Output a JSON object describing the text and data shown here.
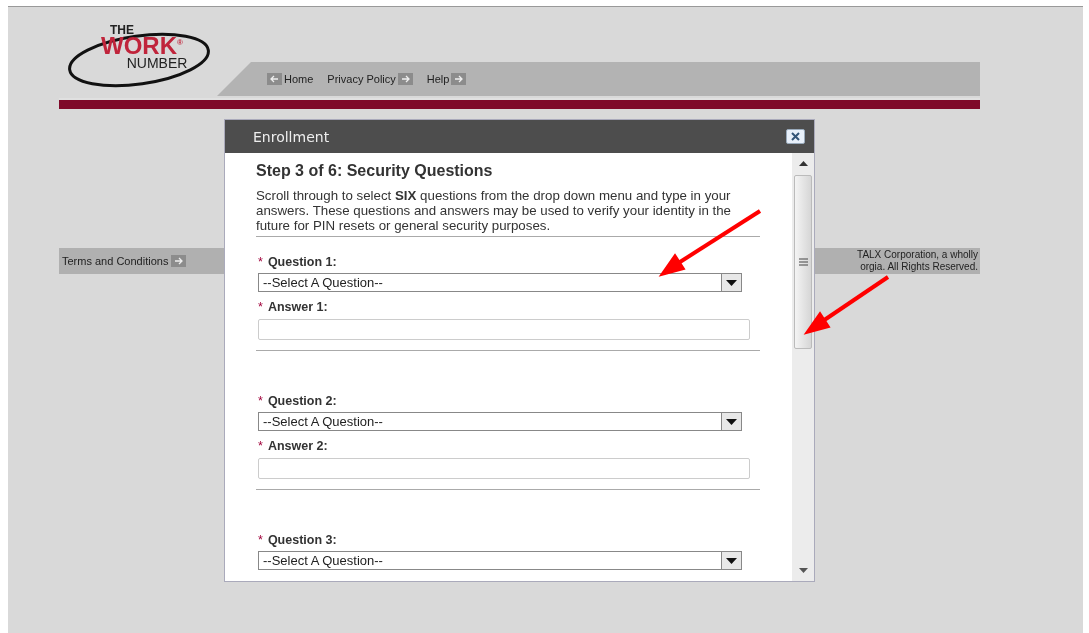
{
  "logo": {
    "top": "THE",
    "middle": "WORK",
    "registered": "®",
    "bottom": "NUMBER"
  },
  "nav": [
    {
      "label": "Home",
      "back": true
    },
    {
      "label": "Privacy Policy",
      "back": false
    },
    {
      "label": "Help",
      "back": false
    }
  ],
  "footer": {
    "link": "Terms and Conditions",
    "copyright": [
      "TALX Corporation, a wholly",
      "orgia. All Rights Reserved."
    ]
  },
  "dialog": {
    "title": "Enrollment",
    "heading": "Step 3 of 6: Security Questions",
    "intro": "Scroll through to select **SIX** questions from the drop down menu and type in your answers. These questions and answers may be used to verify your identity in the future for PIN resets or general security purposes.",
    "questions": [
      {
        "mark": "*",
        "label": "Question 1:",
        "value": "--Select A Question--",
        "answer_mark": "*",
        "answer_label": "Answer 1:"
      },
      {
        "mark": "*",
        "label": "Question 2:",
        "value": "--Select A Question--",
        "answer_mark": "*",
        "answer_label": "Answer 2:"
      },
      {
        "mark": "*",
        "label": "Question 3:",
        "value": "--Select A Question--"
      }
    ]
  }
}
